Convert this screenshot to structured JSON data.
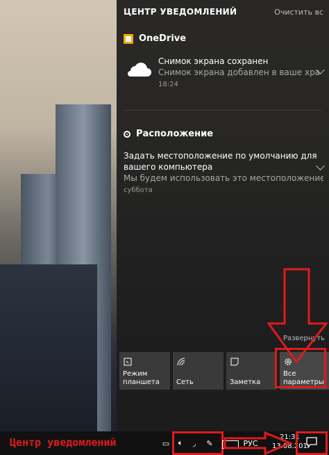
{
  "action_center": {
    "title": "ЦЕНТР УВЕДОМЛЕНИЙ",
    "clear_all": "Очистить вс",
    "expand_label": "Развернуть"
  },
  "onedrive": {
    "app_name": "OneDrive",
    "notification": {
      "title": "Снимок экрана сохранен",
      "body": "Снимок экрана добавлен в ваше хра",
      "time": "18:24"
    }
  },
  "location": {
    "app_name": "Расположение",
    "notification": {
      "title_line1": "Задать местоположение по умолчанию для",
      "title_line2": "вашего компьютера",
      "body": "Мы будем использовать это местоположение",
      "time": "суббота"
    }
  },
  "quick_actions": [
    {
      "line1": "Режим",
      "line2": "планшета",
      "icon": "tablet-mode-icon"
    },
    {
      "line1": "Сеть",
      "line2": "",
      "icon": "network-icon"
    },
    {
      "line1": "Заметка",
      "line2": "",
      "icon": "note-icon"
    },
    {
      "line1": "Все",
      "line2": "параметры",
      "icon": "settings-gear-icon"
    }
  ],
  "taskbar": {
    "caption": "Центр уведомлений",
    "language": "РУС",
    "time": "21:31",
    "date": "13.08.201"
  },
  "colors": {
    "annotation_red": "#e01b1b",
    "onedrive_orange": "#f7a600",
    "panel_bg": "#1c1c1c"
  }
}
